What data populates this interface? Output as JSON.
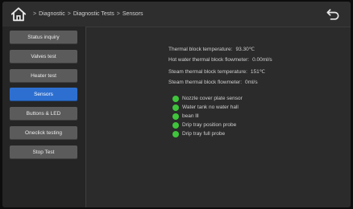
{
  "header": {
    "breadcrumb": [
      "Diagnostic",
      "Diagnostic Tests",
      "Sensors"
    ],
    "home_icon": "home-icon",
    "back_icon": "back-arrow-icon"
  },
  "sidebar": {
    "active_color": "#2d6fd0",
    "items": [
      {
        "label": "Status inquiry"
      },
      {
        "label": "Valves test"
      },
      {
        "label": "Heater test"
      },
      {
        "label": "Sensors",
        "active": true
      },
      {
        "label": "Buttons & LED"
      },
      {
        "label": "Oneclick testing"
      },
      {
        "label": "Stop Test"
      }
    ]
  },
  "readings": [
    {
      "label": "Thermal block temperature:",
      "value": "93.30℃"
    },
    {
      "label": "Hot water thermal block flowmeter:",
      "value": "0.00ml/s"
    },
    {
      "label": "Steam thermal block temperature:",
      "value": "151℃"
    },
    {
      "label": "Steam thermal block flowmeter:",
      "value": "0ml/s"
    }
  ],
  "status_color": "#3fc43b",
  "statuses": [
    {
      "label": "Nozzle cover plate sensor"
    },
    {
      "label": "Water tank no water hall"
    },
    {
      "label": "bean lll"
    },
    {
      "label": "Drip tray position probe"
    },
    {
      "label": "Drip tray full probe"
    }
  ]
}
